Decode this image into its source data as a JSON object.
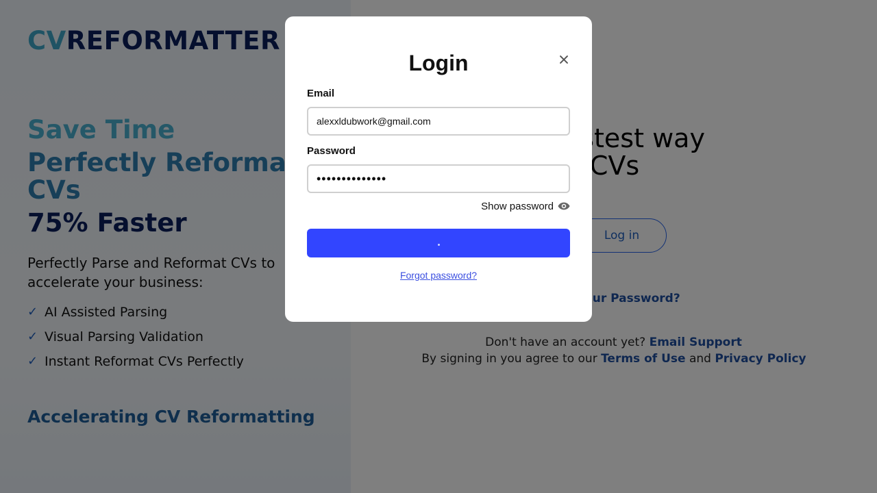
{
  "brand": {
    "logo_cv": "CV",
    "logo_rest": "REFORMATTER"
  },
  "hero": {
    "line1": "Save Time",
    "line2": "Perfectly Reformat",
    "line3": "CVs",
    "line4": "75% Faster",
    "intro": "Perfectly Parse and Reformat CVs to accelerate your business:",
    "features": [
      "AI Assisted Parsing",
      "Visual Parsing Validation",
      "Instant Reformat CVs Perfectly"
    ],
    "check_glyph": "✓",
    "accelerating": "Accelerating CV Reformatting"
  },
  "right": {
    "tagline_line1": "and Fastest way",
    "tagline_line2": "format CVs",
    "login_button": "Log in",
    "forgot_password_partial": "your Password?",
    "no_account": "Don't have an account yet?",
    "email_support": "Email Support",
    "agree_prefix": "By signing in you agree to our",
    "terms": "Terms of Use",
    "and": "and",
    "privacy": "Privacy Policy"
  },
  "modal": {
    "title": "Login",
    "email_label": "Email",
    "email_value": "alexxldubwork@gmail.com",
    "password_label": "Password",
    "password_value": "••••••••••••••",
    "show_password": "Show password",
    "forgot_password": "Forgot password?",
    "close_icon": "close-icon",
    "eye_icon": "eye-icon"
  },
  "colors": {
    "accent": "#3245ff",
    "brand_dark": "#0b1f5c",
    "brand_light": "#3fa7c9",
    "link": "#1e4fa0"
  }
}
